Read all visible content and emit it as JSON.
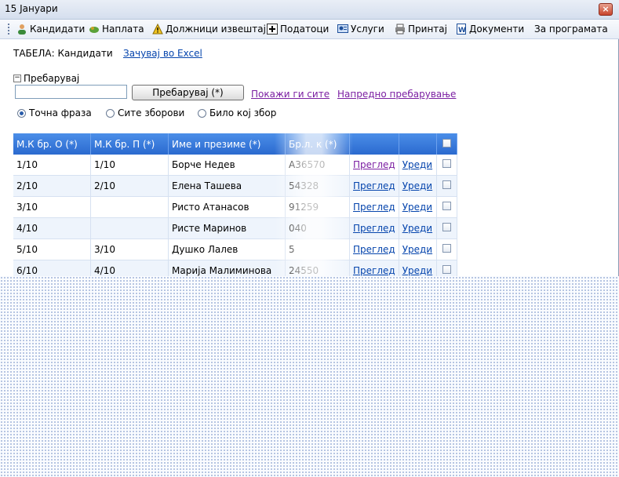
{
  "window": {
    "title": "15 Јануари",
    "close": "×"
  },
  "menu": [
    {
      "label": "Кандидати",
      "icon": "user-icon"
    },
    {
      "label": "Наплата",
      "icon": "money-icon"
    },
    {
      "label": "Должници извештај",
      "icon": "warning-icon"
    },
    {
      "label": "Податоци",
      "icon": "plus-icon"
    },
    {
      "label": "Услуги",
      "icon": "services-icon"
    },
    {
      "label": "Принтај",
      "icon": "printer-icon"
    },
    {
      "label": "Документи",
      "icon": "word-document-icon"
    },
    {
      "label": "За програмата",
      "icon": ""
    }
  ],
  "page": {
    "table_label": "ТАБЕЛА: Кандидати",
    "excel_link": "Зачувај во Excel"
  },
  "search": {
    "toggle_label": "Пребарувај",
    "input_value": "",
    "button_label": "Пребарувај (*)",
    "show_all": "Покажи ги сите",
    "advanced": "Напредно пребарување",
    "options": [
      {
        "label": "Точна фраза",
        "selected": true
      },
      {
        "label": "Сите зборови",
        "selected": false
      },
      {
        "label": "Било кој збор",
        "selected": false
      }
    ]
  },
  "grid": {
    "columns": [
      "М.К бр. О (*)",
      "М.К бр. П (*)",
      "Име и презиме (*)",
      "Бр.л. к (*)",
      "",
      ""
    ],
    "view_label": "Преглед",
    "edit_label": "Уреди",
    "rows": [
      {
        "mko": "1/10",
        "mkp": "1/10",
        "name": "Борче Недев",
        "brlk": "А36570"
      },
      {
        "mko": "2/10",
        "mkp": "2/10",
        "name": "Елена Ташева",
        "brlk": "54328"
      },
      {
        "mko": "3/10",
        "mkp": "",
        "name": "Ристо Атанасов",
        "brlk": "91259"
      },
      {
        "mko": "4/10",
        "mkp": "",
        "name": "Ристе Маринов",
        "brlk": "040"
      },
      {
        "mko": "5/10",
        "mkp": "3/10",
        "name": "Душко Лалев",
        "brlk": "5"
      },
      {
        "mko": "6/10",
        "mkp": "4/10",
        "name": "Марија Малиминова",
        "brlk": "24550"
      }
    ]
  }
}
